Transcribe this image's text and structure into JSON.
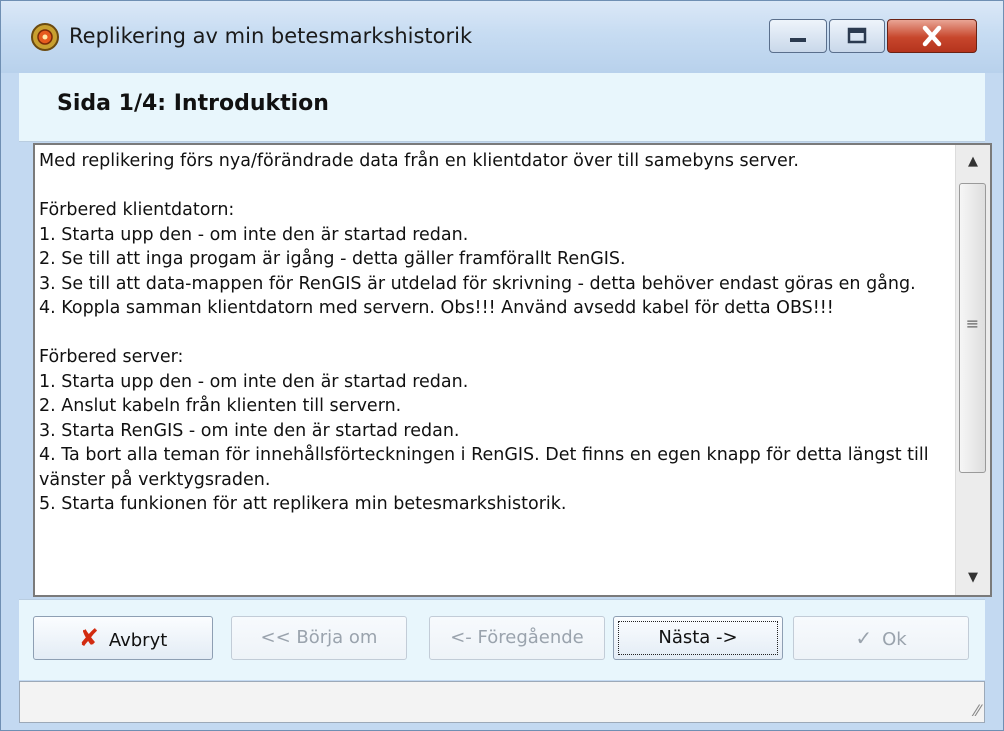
{
  "window": {
    "title": "Replikering av min betesmarkshistorik",
    "icons": [
      "app-icon",
      "minimize-icon",
      "maximize-icon",
      "close-icon"
    ]
  },
  "header": {
    "page_title": "Sida 1/4: Introduktion"
  },
  "content": {
    "text": "Med replikering förs nya/förändrade data från en klientdator över till samebyns server.\n\nFörbered klientdatorn:\n1. Starta upp den - om inte den är startad redan.\n2. Se till att inga progam är igång - detta gäller framförallt RenGIS.\n3. Se till att data-mappen för RenGIS är utdelad för skrivning - detta behöver endast göras en gång.\n4. Koppla samman klientdatorn med servern. Obs!!! Använd avsedd kabel för detta OBS!!!\n\nFörbered server:\n1. Starta upp den - om inte den är startad redan.\n2. Anslut kabeln från klienten till servern.\n3. Starta RenGIS - om inte den är startad redan.\n4. Ta bort alla teman för innehållsförteckningen i RenGIS. Det finns en egen knapp för detta längst till vänster på verktygsraden.\n5. Starta funkionen för att replikera min betesmarkshistorik."
  },
  "buttons": {
    "cancel": "Avbryt",
    "restart": "<< Börja om",
    "previous": "<- Föregående",
    "next": "Nästa ->",
    "ok": "Ok"
  },
  "colors": {
    "window_frame": "#c3d9f1",
    "header_band": "#e8f6fc",
    "cancel_icon": "#d22b10",
    "close_button": "#c7462c"
  }
}
